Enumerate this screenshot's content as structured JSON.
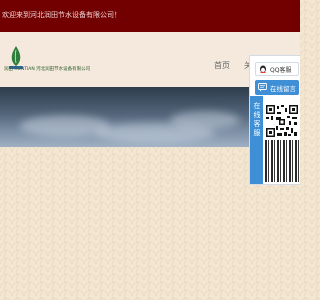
{
  "topbar": {
    "welcome": "欢迎来到河北润田节水设备有限公司！"
  },
  "header": {
    "logo_text": "润田 RUNTIAN 河北润田节水设备有限公司",
    "nav": [
      "首页",
      "关于"
    ]
  },
  "kefu": {
    "qq_label": "QQ客服",
    "chat_label": "在线留言",
    "tab_label": "在线客服",
    "accent": "#3e8fd6"
  },
  "colors": {
    "topbar": "#730000",
    "background": "#f3e6d2"
  }
}
